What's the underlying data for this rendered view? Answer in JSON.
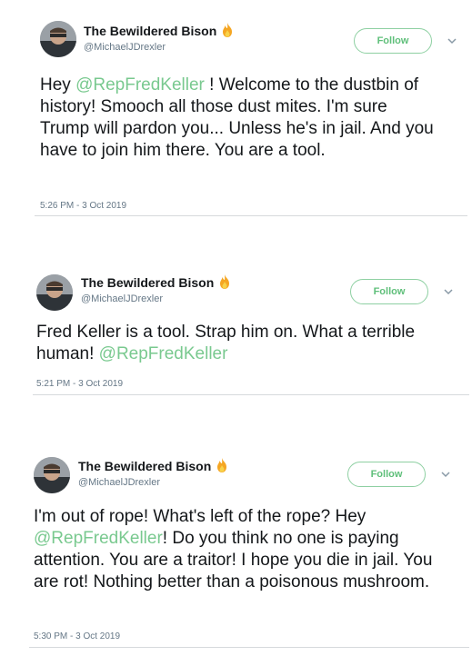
{
  "accent_color": "#79c98f",
  "tweets": [
    {
      "display_name": "The Bewildered Bison",
      "name_icon": "fire-icon",
      "handle": "@MichaelJDrexler",
      "follow_label": "Follow",
      "text_parts": [
        "Hey ",
        "@RepFredKeller",
        " ! Welcome to the dustbin of history! Smooch all those dust mites. I'm sure Trump will pardon you... Unless he's in jail. And you have to join him there. You are a tool."
      ],
      "timestamp": "5:26 PM - 3 Oct 2019"
    },
    {
      "display_name": "The Bewildered Bison",
      "name_icon": "fire-icon",
      "handle": "@MichaelJDrexler",
      "follow_label": "Follow",
      "text_parts": [
        "Fred Keller is a tool. Strap him on. What a terrible human! ",
        "@RepFredKeller",
        ""
      ],
      "timestamp": "5:21 PM - 3 Oct 2019"
    },
    {
      "display_name": "The Bewildered Bison",
      "name_icon": "fire-icon",
      "handle": "@MichaelJDrexler",
      "follow_label": "Follow",
      "text_parts": [
        "I'm out of rope! What's left of the rope? Hey ",
        "@RepFredKeller",
        "! Do you think no one is paying attention. You are a traitor! I hope you die in jail. You are rot! Nothing better than a poisonous mushroom."
      ],
      "timestamp": "5:30 PM - 3 Oct 2019"
    }
  ]
}
